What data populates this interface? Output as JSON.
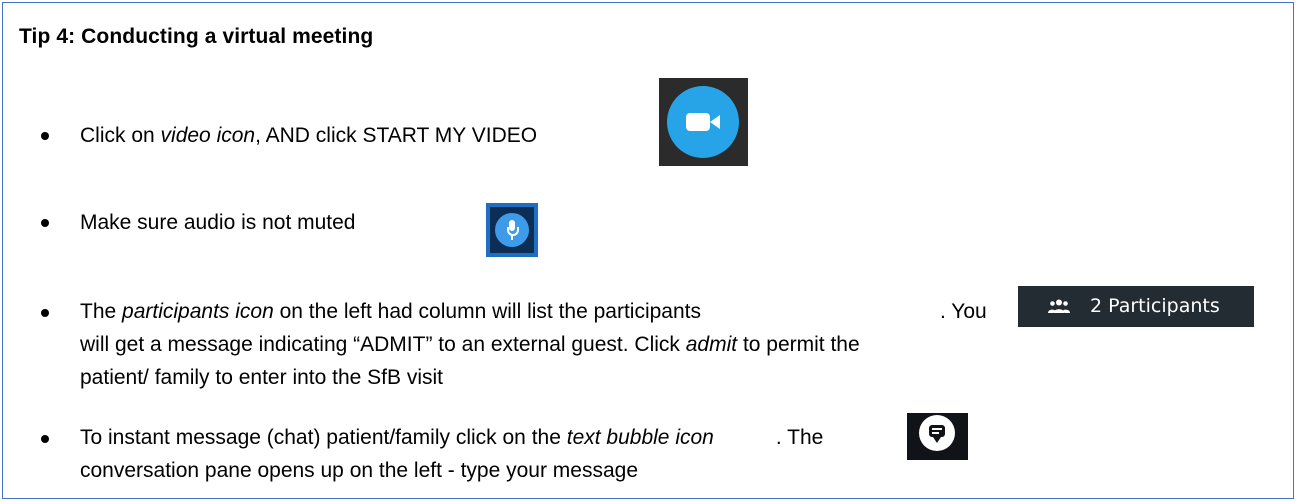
{
  "title": "Tip 4: Conducting a virtual meeting",
  "bullets": [
    {
      "pre": "Click on ",
      "em": "video icon",
      "post": ", AND click START MY VIDEO"
    },
    {
      "text": "Make sure audio is not muted"
    },
    {
      "pre": "The ",
      "em": "participants icon",
      "mid": " on the left had column will list the participants",
      "after_icon": ". You",
      "line2_pre": "will get a message indicating “ADMIT” to an external guest. Click ",
      "line2_em": "admit",
      "line2_post": " to permit the",
      "line3": "patient/ family to enter into the SfB visit"
    },
    {
      "pre": "To instant message (chat) patient/family click on the ",
      "em": "text bubble icon",
      "after_icon": ".  The",
      "line2": "conversation pane opens up on the left - type your message"
    }
  ],
  "icons": {
    "video": "video-camera-icon",
    "mic": "microphone-icon",
    "participants": "people-icon",
    "chat": "chat-bubble-icon"
  },
  "participants_button": {
    "label": "2 Participants"
  },
  "colors": {
    "border": "#4472c4",
    "video_blue": "#27a4e8",
    "mic_blue": "#3d9be9",
    "dark_button": "#232b33"
  }
}
